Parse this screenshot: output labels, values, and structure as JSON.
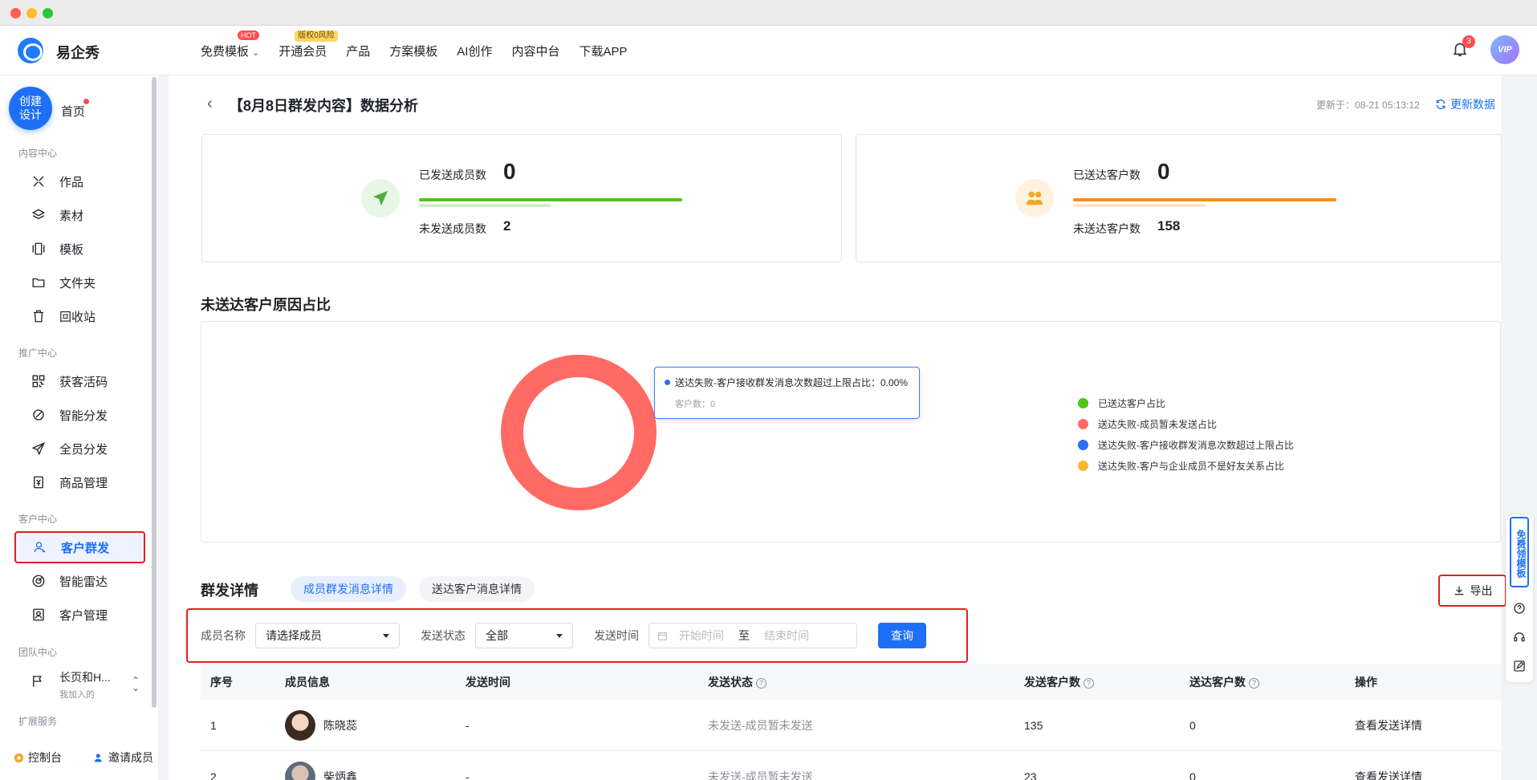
{
  "app": {
    "brand": "易企秀"
  },
  "topnav": [
    {
      "label": "免费模板",
      "badge": "HOT",
      "dropdown": true
    },
    {
      "label": "开通会员",
      "badge": "版权0风险"
    },
    {
      "label": "产品"
    },
    {
      "label": "方案模板"
    },
    {
      "label": "AI创作"
    },
    {
      "label": "内容中台"
    },
    {
      "label": "下载APP"
    }
  ],
  "header": {
    "notification_count": "3",
    "avatar_label": "VIP"
  },
  "sidebar": {
    "create_label": "创建设计",
    "home": "首页",
    "sections": {
      "content": "内容中心",
      "promo": "推广中心",
      "customer": "客户中心",
      "team": "团队中心",
      "ext": "扩展服务"
    },
    "items": [
      {
        "label": "作品",
        "icon": "tools-icon"
      },
      {
        "label": "素材",
        "icon": "layers-icon"
      },
      {
        "label": "模板",
        "icon": "template-icon"
      },
      {
        "label": "文件夹",
        "icon": "folder-icon"
      },
      {
        "label": "回收站",
        "icon": "trash-icon"
      },
      {
        "label": "获客活码",
        "icon": "qrcode-icon"
      },
      {
        "label": "智能分发",
        "icon": "smart-distribute-icon"
      },
      {
        "label": "全员分发",
        "icon": "send-icon"
      },
      {
        "label": "商品管理",
        "icon": "product-icon"
      },
      {
        "label": "客户群发",
        "icon": "user-broadcast-icon",
        "active": true
      },
      {
        "label": "智能雷达",
        "icon": "radar-icon"
      },
      {
        "label": "客户管理",
        "icon": "customer-icon"
      }
    ],
    "team_name": "长页和H...",
    "team_sub": "我加入的",
    "console": "控制台",
    "invite": "邀请成员"
  },
  "page": {
    "title": "【8月8日群发内容】数据分析",
    "updated": "更新于：08-21 05:13:12",
    "refresh": "更新数据"
  },
  "stats": {
    "members": {
      "sent_label": "已发送成员数",
      "sent_value": "0",
      "unsent_label": "未发送成员数",
      "unsent_value": "2"
    },
    "customers": {
      "reached_label": "已送达客户数",
      "reached_value": "0",
      "unreached_label": "未送达客户数",
      "unreached_value": "158"
    }
  },
  "chart_section_title": "未送达客户原因占比",
  "chart_data": {
    "type": "pie",
    "donut": true,
    "categories": [
      "已送达客户占比",
      "送达失败-成员暂未发送占比",
      "送达失败-客户接收群发消息次数超过上限占比",
      "送达失败-客户与企业成员不是好友关系占比"
    ],
    "values": [
      0,
      100,
      0,
      0
    ],
    "colors": [
      "#52c41a",
      "#ff6b64",
      "#2f6ef5",
      "#f5b82e"
    ],
    "legend_position": "right",
    "tooltip": {
      "title": "送达失败-客户接收群发消息次数超过上限占比：0.00%",
      "sub": "客户数：0"
    }
  },
  "details": {
    "title": "群发详情",
    "tabs": [
      "成员群发消息详情",
      "送达客户消息详情"
    ],
    "export": "导出",
    "filters": {
      "member_label": "成员名称",
      "member_placeholder": "请选择成员",
      "status_label": "发送状态",
      "status_value": "全部",
      "time_label": "发送时间",
      "start_placeholder": "开始时间",
      "to": "至",
      "end_placeholder": "结束时间",
      "query": "查询"
    },
    "columns": [
      "序号",
      "成员信息",
      "发送时间",
      "发送状态",
      "发送客户数",
      "送达客户数",
      "操作"
    ],
    "rows": [
      {
        "idx": "1",
        "name": "陈晓蕊",
        "time": "-",
        "status": "未发送-成员暂未发送",
        "sent": "135",
        "reached": "0",
        "action": "查看发送详情"
      },
      {
        "idx": "2",
        "name": "柴炳鑫",
        "time": "-",
        "status": "未发送-成员暂未发送",
        "sent": "23",
        "reached": "0",
        "action": "查看发送详情"
      }
    ]
  },
  "float_bar": {
    "free_template": "免费领模板"
  }
}
